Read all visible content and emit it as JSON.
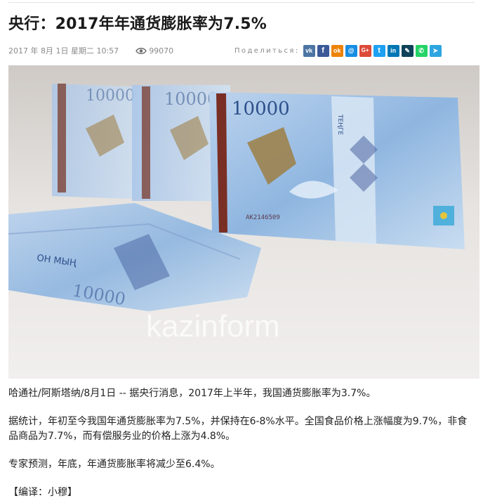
{
  "article": {
    "title": "央行：2017年年通货膨胀率为7.5%",
    "date": "2017 年 8月 1日 星期二 10:57",
    "views": "99070",
    "share_label": "Поделиться:",
    "share_buttons": [
      {
        "name": "vk",
        "glyph": "vk",
        "color": "#4c75a3"
      },
      {
        "name": "facebook",
        "glyph": "f",
        "color": "#3b5998"
      },
      {
        "name": "odnoklassniki",
        "glyph": "ok",
        "color": "#ee8208"
      },
      {
        "name": "moimir",
        "glyph": "@",
        "color": "#168de2"
      },
      {
        "name": "googleplus",
        "glyph": "G+",
        "color": "#dd4b39"
      },
      {
        "name": "twitter",
        "glyph": "t",
        "color": "#1da1f2"
      },
      {
        "name": "linkedin",
        "glyph": "in",
        "color": "#0077b5"
      },
      {
        "name": "livejournal",
        "glyph": "✎",
        "color": "#0d425a"
      },
      {
        "name": "whatsapp",
        "glyph": "✆",
        "color": "#25d366"
      },
      {
        "name": "telegram",
        "glyph": "➤",
        "color": "#2ca5e0"
      }
    ],
    "photo": {
      "watermark": "kazinform",
      "note_denomination": "10000",
      "note_text": "ОН МЫҢ",
      "note_currency": "ТЕҢГЕ",
      "serial": "АК2146509"
    },
    "paragraphs": [
      "哈通社/阿斯塔纳/8月1日 -- 据央行消息，2017年上半年，我国通货膨胀率为3.7%。",
      "据统计，年初至今我国年通货膨胀率为7.5%，并保持在6-8%水平。全国食品价格上涨幅度为9.7%，非食品商品为7.7%，而有偿服务业的价格上涨为4.8%。",
      "专家预测，年底，年通货膨胀率将减少至6.4%。",
      "【编译：小穆】"
    ]
  }
}
